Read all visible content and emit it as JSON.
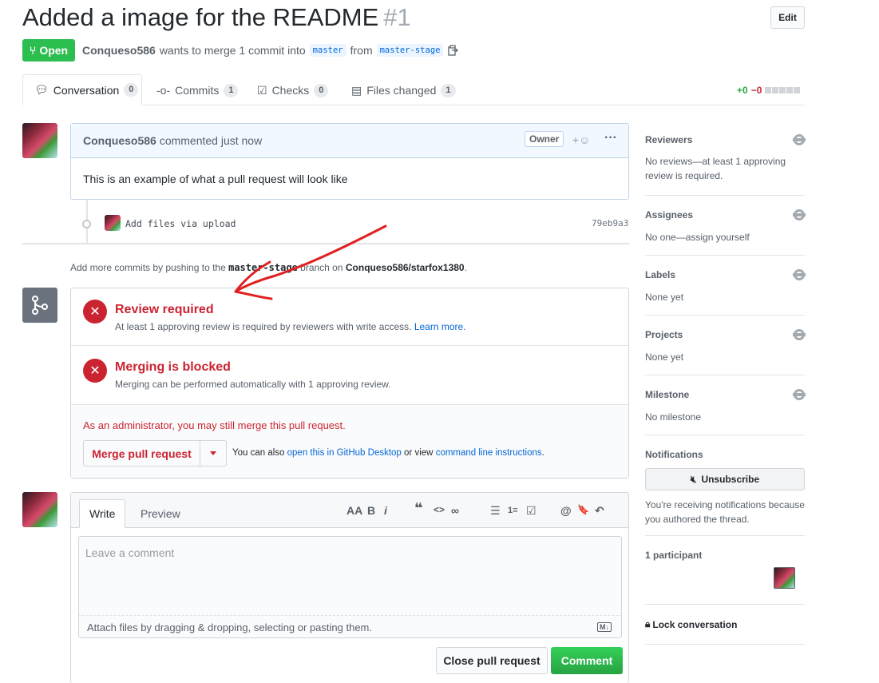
{
  "header": {
    "title": "Added a image for the README",
    "number": "#1",
    "edit_label": "Edit",
    "state_label": "Open",
    "author": "Conqueso586",
    "merge_text": "wants to merge 1 commit into",
    "base_branch": "master",
    "from_word": "from",
    "head_branch": "master-stage"
  },
  "tabs": [
    {
      "label": "Conversation",
      "count": "0"
    },
    {
      "label": "Commits",
      "count": "1"
    },
    {
      "label": "Checks",
      "count": "0"
    },
    {
      "label": "Files changed",
      "count": "1"
    }
  ],
  "diffstat": {
    "added": "+0",
    "removed": "−0"
  },
  "comment": {
    "author": "Conqueso586",
    "action": "commented just now",
    "badge": "Owner",
    "body": "This is an example of what a pull request will look like"
  },
  "commit": {
    "message": "Add files via upload",
    "sha": "79eb9a3"
  },
  "push_hint": {
    "prefix": "Add more commits by pushing to the",
    "branch": "master-stage",
    "middle": "branch on",
    "repo": "Conqueso586/starfox1380",
    "suffix": "."
  },
  "merge": {
    "review_title": "Review required",
    "review_desc": "At least 1 approving review is required by reviewers with write access.",
    "learn_more": "Learn more.",
    "blocked_title": "Merging is blocked",
    "blocked_desc": "Merging can be performed automatically with 1 approving review.",
    "admin_note": "As an administrator, you may still merge this pull request.",
    "merge_button": "Merge pull request",
    "also_prefix": "You can also",
    "desktop_link": "open this in GitHub Desktop",
    "also_middle": "or view",
    "cli_link": "command line instructions",
    "also_suffix": "."
  },
  "editor": {
    "write_tab": "Write",
    "preview_tab": "Preview",
    "placeholder": "Leave a comment",
    "attach_text": "Attach files by dragging & dropping, selecting or pasting them.",
    "md_badge": "M↓",
    "close_button": "Close pull request",
    "comment_button": "Comment",
    "toolbar": [
      "AA",
      "B",
      "i",
      "❝",
      "<>",
      "∞",
      "☰",
      "1≡",
      "☑",
      "@",
      "🔖",
      "↶"
    ]
  },
  "sidebar": {
    "reviewers_h": "Reviewers",
    "reviewers_v": "No reviews—at least 1 approving review is required.",
    "assignees_h": "Assignees",
    "assignees_v": "No one—assign yourself",
    "labels_h": "Labels",
    "labels_v": "None yet",
    "projects_h": "Projects",
    "projects_v": "None yet",
    "milestone_h": "Milestone",
    "milestone_v": "No milestone",
    "notifications_h": "Notifications",
    "unsubscribe": "Unsubscribe",
    "notif_reason": "You're receiving notifications because you authored the thread.",
    "participants": "1 participant",
    "lock": "Lock conversation"
  },
  "colors": {
    "open_green": "#2cbe4e",
    "error_red": "#cb2431",
    "link_blue": "#0366d6",
    "annotation": "#e02020"
  }
}
